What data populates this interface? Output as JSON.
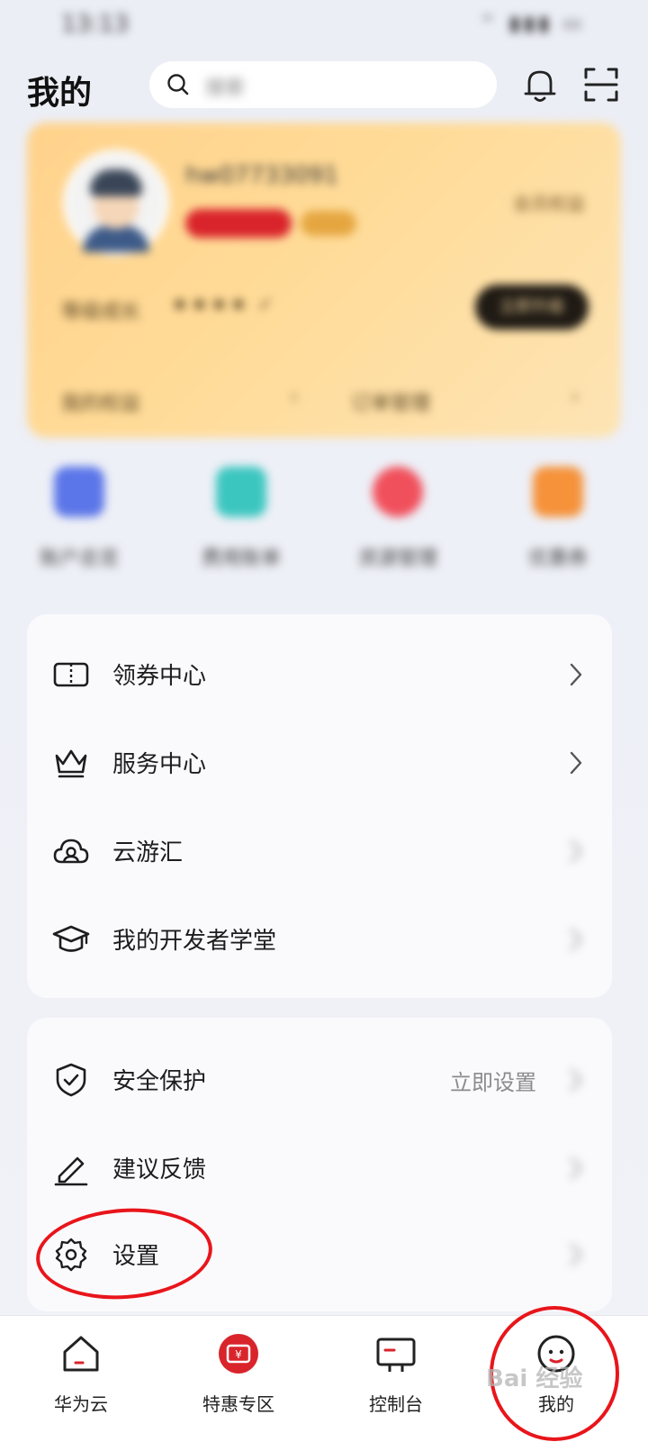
{
  "status_bar": {
    "time": "13:13",
    "icons": "⌃ ▮▮▮ ▭"
  },
  "header": {
    "title": "我的",
    "search_placeholder": "搜索"
  },
  "vip_card": {
    "username": "hw07733091",
    "member_link": "会员权益",
    "stat_label": "等级成长",
    "stars": "★★★★ ✓",
    "action_button": "立即升级",
    "footer_left": "我的权益",
    "footer_right": "订单管理"
  },
  "quick_actions": [
    {
      "label": "账户总览",
      "color": "#5b76e8"
    },
    {
      "label": "费用账单",
      "color": "#3cc6c0"
    },
    {
      "label": "资源管理",
      "color": "#f0505c"
    },
    {
      "label": "优惠券",
      "color": "#f5923a"
    }
  ],
  "menu_primary": [
    {
      "label": "领券中心",
      "icon": "coupon-icon"
    },
    {
      "label": "服务中心",
      "icon": "crown-icon"
    },
    {
      "label": "云游汇",
      "icon": "cloud-user-icon"
    },
    {
      "label": "我的开发者学堂",
      "icon": "graduation-cap-icon"
    }
  ],
  "menu_secondary": [
    {
      "label": "安全保护",
      "icon": "shield-check-icon",
      "right_text": "立即设置"
    },
    {
      "label": "建议反馈",
      "icon": "pen-icon"
    },
    {
      "label": "设置",
      "icon": "gear-icon"
    }
  ],
  "tabbar": [
    {
      "label": "华为云",
      "icon": "home-icon"
    },
    {
      "label": "特惠专区",
      "icon": "deal-icon"
    },
    {
      "label": "控制台",
      "icon": "console-icon"
    },
    {
      "label": "我的",
      "icon": "profile-icon"
    }
  ],
  "watermark": "Bai 经验",
  "colors": {
    "accent_red": "#d9242b",
    "highlight_red": "#e8151b",
    "vip_gold": "#ffd28b"
  }
}
